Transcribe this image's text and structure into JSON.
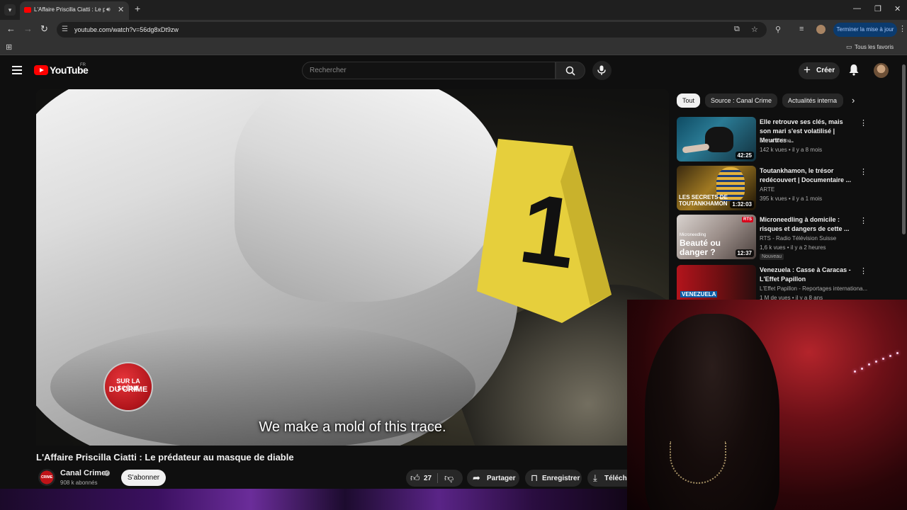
{
  "browser": {
    "tab_title": "L'Affaire Priscilla Ciatti : Le p",
    "url": "youtube.com/watch?v=56dg8xDt9zw",
    "update_button": "Terminer la mise à jour",
    "bookmarks_all": "Tous les favoris"
  },
  "header": {
    "wordmark": "YouTube",
    "country": "FR",
    "search_placeholder": "Rechercher",
    "create_label": "Créer"
  },
  "video": {
    "subtitle": "We make a mold of this trace.",
    "logo_line1": "SUR LA SCÈNE",
    "logo_line2": "DU CRIME",
    "marker_number": "1",
    "title": "L'Affaire Priscilla Ciatti : Le prédateur au masque de diable",
    "channel": "Canal Crime",
    "channel_avatar_text": "CRIME",
    "subscribers": "908 k abonnés",
    "subscribe": "S'abonner",
    "likes": "27",
    "share": "Partager",
    "save": "Enregistrer",
    "download": "Téléch"
  },
  "chips": [
    "Tout",
    "Source : Canal Crime",
    "Actualités interna"
  ],
  "related": [
    {
      "title": "Elle retrouve ses clés, mais son mari s'est volatilisé | Meurtres ...",
      "channel": "Canal Crime",
      "meta": "142 k vues • il y a 8 mois",
      "duration": "42:25",
      "badge": "",
      "thumb_text": ""
    },
    {
      "title": "Toutankhamon, le trésor redécouvert | Documentaire ...",
      "channel": "ARTE",
      "meta": "395 k vues • il y a 1 mois",
      "duration": "1:32:03",
      "badge": "",
      "thumb_text": "LES SECRETS DE TOUTANKHAMON"
    },
    {
      "title": "Microneedling à domicile : risques et dangers de cette ...",
      "channel": "RTS - Radio Télévision Suisse",
      "meta": "1,6 k vues • il y a 2 heures",
      "duration": "12:37",
      "badge": "Nouveau",
      "thumb_text": "Beauté ou danger ?",
      "thumb_small": "Microneedling",
      "thumb_logo": "RTS"
    },
    {
      "title": "Venezuela : Casse à Caracas - L'Effet Papillon",
      "channel": "L'Effet Papillon - Reportages internationa...",
      "meta": "1 M de vues • il y a 8 ans",
      "duration": "",
      "badge": "",
      "thumb_text": "VENEZUELA"
    }
  ],
  "colors": {
    "brand_red": "#ff0000",
    "background": "#0f0f0f",
    "chip_bg": "#272727",
    "marker_yellow": "#e6cf3c",
    "update_blue": "#0b3b6f"
  }
}
